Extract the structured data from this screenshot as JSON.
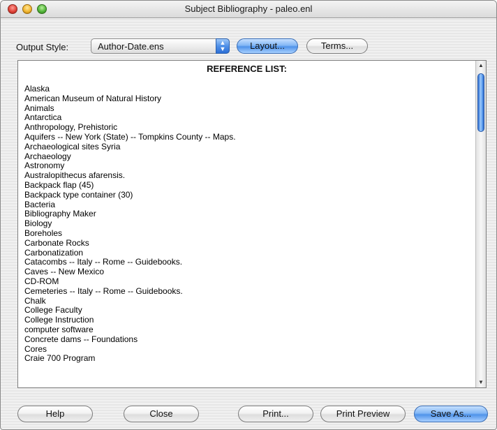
{
  "window": {
    "title": "Subject Bibliography - paleo.enl"
  },
  "controls": {
    "output_style_label": "Output Style:",
    "output_style_value": "Author-Date.ens",
    "layout_label": "Layout...",
    "terms_label": "Terms..."
  },
  "reference_list": {
    "header": "REFERENCE LIST:",
    "items": [
      "Alaska",
      "American Museum of Natural History",
      "Animals",
      "Antarctica",
      "Anthropology, Prehistoric",
      "Aquifers -- New York (State) -- Tompkins County -- Maps.",
      "Archaeological sites Syria",
      "Archaeology",
      "Astronomy",
      "Australopithecus afarensis.",
      "Backpack flap (45)",
      "Backpack type container (30)",
      "Bacteria",
      "Bibliography Maker",
      "Biology",
      "Boreholes",
      "Carbonate Rocks",
      "Carbonatization",
      "Catacombs -- Italy -- Rome -- Guidebooks.",
      "Caves -- New Mexico",
      "CD-ROM",
      "Cemeteries -- Italy -- Rome -- Guidebooks.",
      "Chalk",
      "College Faculty",
      "College Instruction",
      "computer software",
      "Concrete dams -- Foundations",
      "Cores",
      "Craie 700 Program"
    ]
  },
  "footer": {
    "help_label": "Help",
    "close_label": "Close",
    "print_label": "Print...",
    "print_preview_label": "Print Preview",
    "save_as_label": "Save As..."
  }
}
